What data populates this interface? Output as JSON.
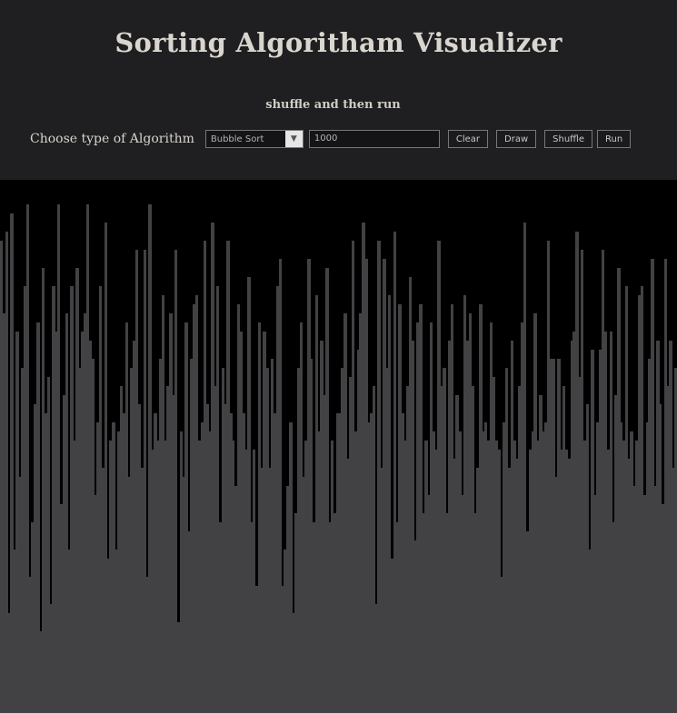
{
  "header": {
    "title": "Sorting Algoritham Visualizer",
    "subtitle": "shuffle and then run"
  },
  "controls": {
    "label": "Choose type of Algorithm",
    "algorithm_selected": "Bubble Sort",
    "size_value": "1000",
    "clear_label": "Clear",
    "draw_label": "Draw",
    "shuffle_label": "Shuffle",
    "run_label": "Run"
  },
  "visualizer": {
    "bar_color": "#424244",
    "background_color": "#000000",
    "values": [
      520,
      440,
      530,
      110,
      550,
      180,
      420,
      260,
      380,
      470,
      560,
      150,
      210,
      340,
      430,
      90,
      490,
      330,
      370,
      120,
      470,
      420,
      560,
      230,
      350,
      440,
      180,
      470,
      300,
      490,
      380,
      420,
      440,
      560,
      410,
      390,
      240,
      320,
      470,
      270,
      540,
      170,
      300,
      320,
      180,
      310,
      360,
      330,
      430,
      260,
      380,
      410,
      510,
      340,
      270,
      510,
      150,
      560,
      290,
      330,
      300,
      390,
      460,
      300,
      360,
      440,
      350,
      510,
      100,
      310,
      260,
      430,
      200,
      390,
      450,
      460,
      300,
      320,
      520,
      340,
      310,
      540,
      360,
      470,
      210,
      380,
      340,
      520,
      330,
      300,
      250,
      450,
      420,
      330,
      290,
      480,
      210,
      290,
      140,
      430,
      270,
      420,
      380,
      270,
      390,
      330,
      470,
      500,
      140,
      180,
      250,
      320,
      110,
      220,
      380,
      430,
      260,
      300,
      500,
      390,
      210,
      460,
      310,
      410,
      350,
      490,
      210,
      300,
      220,
      330,
      330,
      380,
      440,
      280,
      370,
      520,
      310,
      400,
      440,
      540,
      500,
      320,
      330,
      360,
      120,
      520,
      270,
      500,
      380,
      460,
      170,
      530,
      210,
      450,
      330,
      300,
      360,
      480,
      410,
      190,
      430,
      450,
      220,
      300,
      240,
      430,
      310,
      290,
      520,
      360,
      380,
      220,
      410,
      450,
      280,
      350,
      310,
      240,
      460,
      410,
      440,
      360,
      220,
      270,
      450,
      310,
      320,
      300,
      430,
      370,
      300,
      290,
      150,
      320,
      380,
      270,
      410,
      300,
      280,
      360,
      430,
      540,
      200,
      290,
      310,
      440,
      300,
      350,
      310,
      320,
      520,
      390,
      390,
      260,
      390,
      290,
      360,
      290,
      280,
      410,
      420,
      530,
      370,
      510,
      300,
      340,
      180,
      400,
      240,
      320,
      400,
      510,
      420,
      290,
      420,
      210,
      350,
      490,
      320,
      300,
      470,
      280,
      310,
      250,
      300,
      460,
      470,
      240,
      320,
      390,
      500,
      250,
      410,
      340,
      230,
      500,
      360,
      410,
      270,
      380
    ]
  }
}
